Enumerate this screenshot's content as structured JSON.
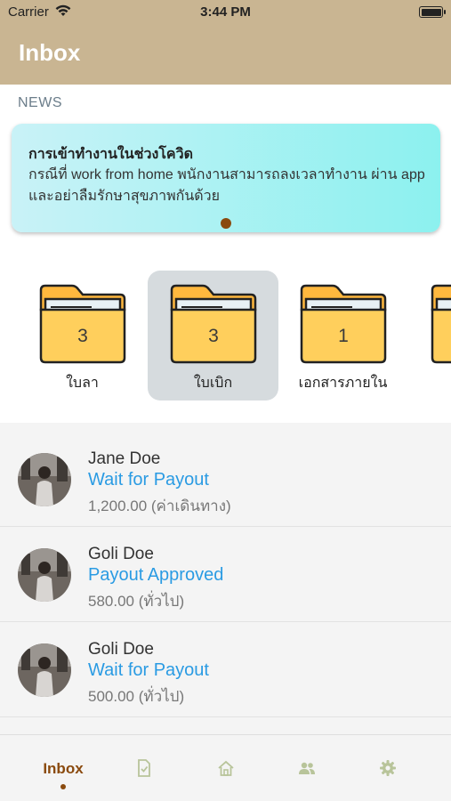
{
  "status_bar": {
    "carrier": "Carrier",
    "time": "3:44 PM"
  },
  "header": {
    "title": "Inbox",
    "background": "#c9b592"
  },
  "news": {
    "section_label": "NEWS",
    "card": {
      "title": "การเข้าทำงานในช่วงโควิด",
      "body": "กรณีที่ work from home พนักงานสามารถลงเวลาทำงาน ผ่าน app และอย่าลืมรักษาสุขภาพกันด้วย"
    }
  },
  "folders": [
    {
      "count": "3",
      "label": "ใบลา",
      "selected": false
    },
    {
      "count": "3",
      "label": "ใบเบิก",
      "selected": true
    },
    {
      "count": "1",
      "label": "เอกสารภายใน",
      "selected": false
    }
  ],
  "list": [
    {
      "name": "Jane Doe",
      "status": "Wait for Payout",
      "amount": "1,200.00 (ค่าเดินทาง)"
    },
    {
      "name": "Goli Doe",
      "status": "Payout Approved",
      "amount": "580.00 (ทั่วไป)"
    },
    {
      "name": "Goli Doe",
      "status": "Wait for Payout",
      "amount": "500.00 (ทั่วไป)"
    }
  ],
  "tab_bar": {
    "active_label": "Inbox",
    "tabs": [
      "inbox",
      "document-check-icon",
      "home-icon",
      "people-icon",
      "settings-gear-icon"
    ]
  },
  "colors": {
    "accent": "#8a4a0e",
    "status_blue": "#2a9be3",
    "folder_yellow": "#ffcf5c",
    "icon_inactive": "#b8c49a"
  }
}
